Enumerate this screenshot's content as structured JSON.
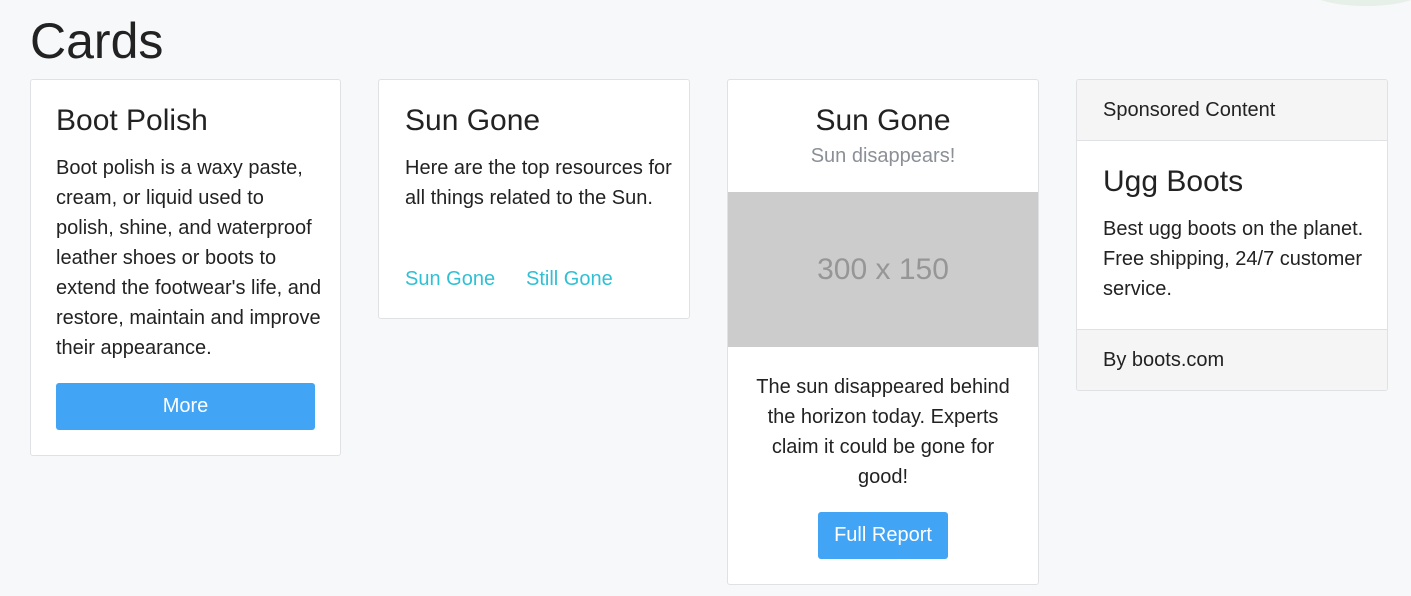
{
  "page": {
    "title": "Cards"
  },
  "cards": [
    {
      "title": "Boot Polish",
      "text": "Boot polish is a waxy paste, cream, or liquid used to polish, shine, and waterproof leather shoes or boots to extend the footwear's life, and restore, maintain and improve their appearance.",
      "button_label": "More"
    },
    {
      "title": "Sun Gone",
      "text": "Here are the top resources for all things related to the Sun.",
      "links": [
        "Sun Gone",
        "Still Gone"
      ]
    },
    {
      "title": "Sun Gone",
      "subtitle": "Sun disappears!",
      "image_label": "300 x 150",
      "text": "The sun disappeared behind the horizon today. Experts claim it could be gone for good!",
      "button_label": "Full Report"
    },
    {
      "header": "Sponsored Content",
      "title": "Ugg Boots",
      "text": "Best ugg boots on the planet. Free shipping, 24/7 customer service.",
      "footer": "By boots.com"
    }
  ],
  "colors": {
    "background": "#f7f8fa",
    "button": "#41a4f5",
    "link": "#2fc0d4",
    "subtitle": "#8a9096",
    "placeholder": "#cccccc"
  }
}
